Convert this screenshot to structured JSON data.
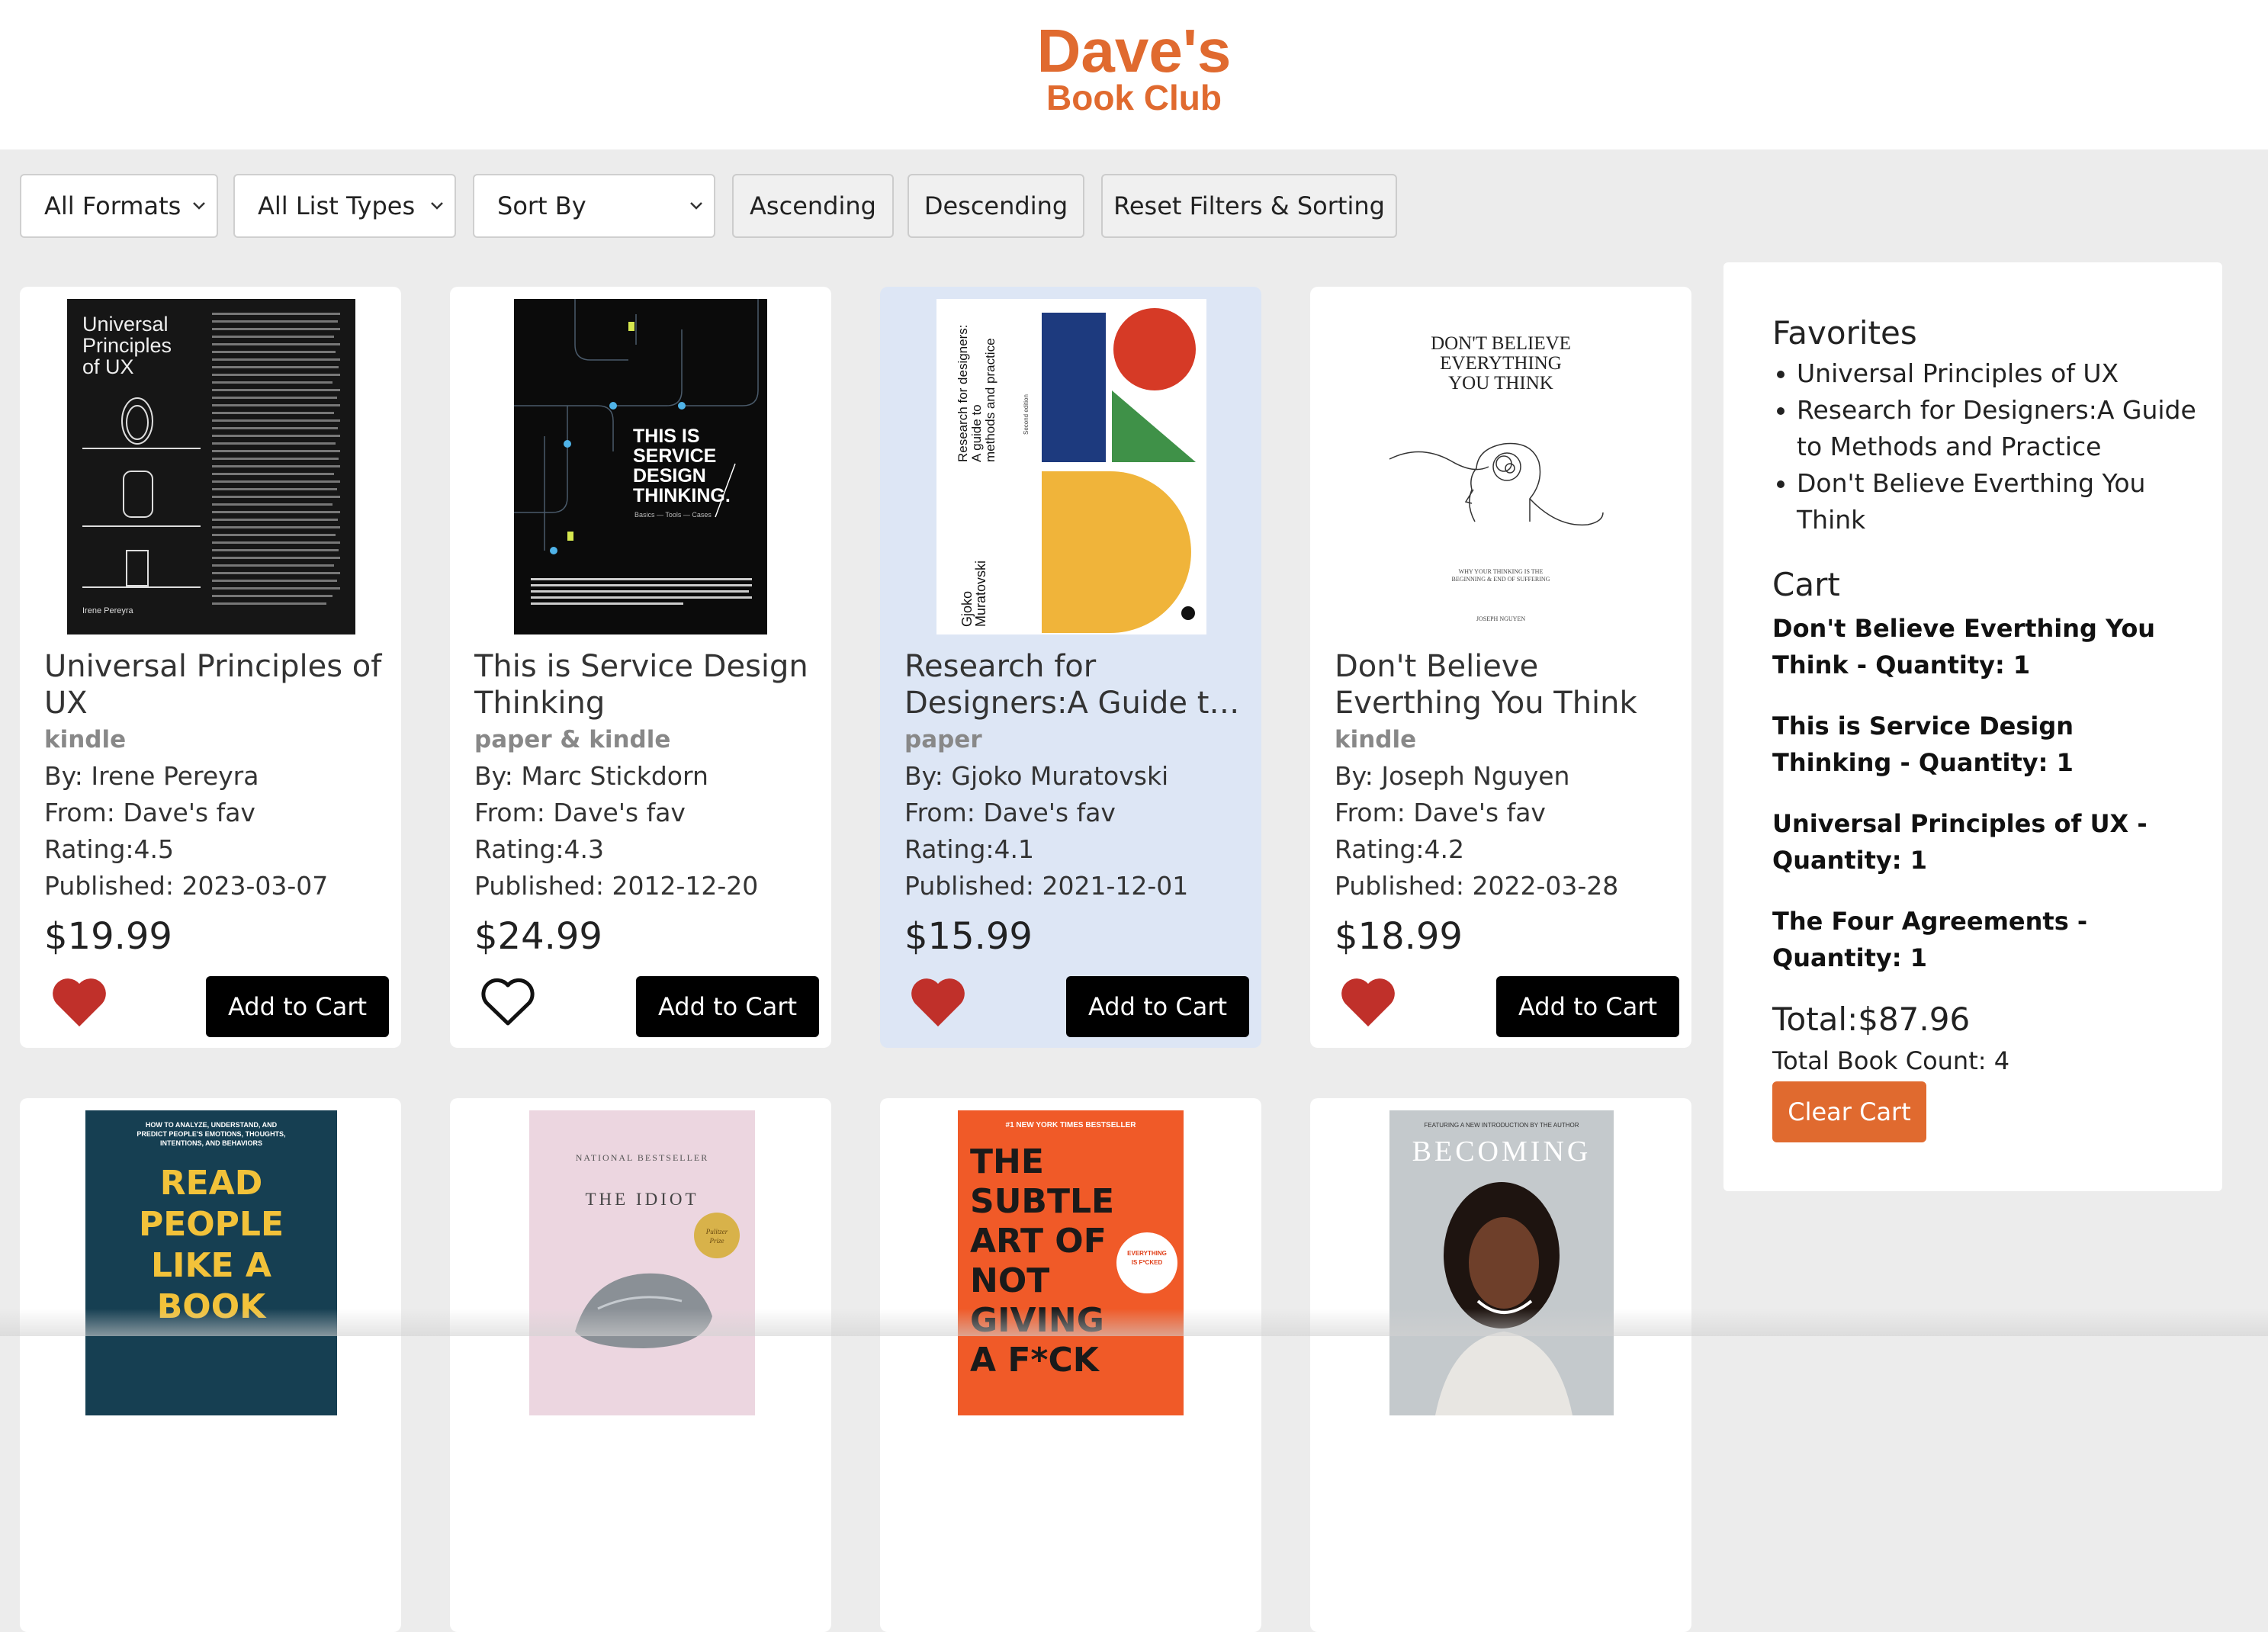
{
  "header": {
    "logo_main": "Dave's",
    "logo_sub": "Book Club"
  },
  "toolbar": {
    "format_select": "All Formats",
    "list_type_select": "All List Types",
    "sort_select": "Sort By",
    "ascending": "Ascending",
    "descending": "Descending",
    "reset": "Reset Filters & Sorting"
  },
  "books": [
    {
      "title": "Universal Principles of UX",
      "format": "kindle",
      "author": "By: Irene Pereyra",
      "from": "From: Dave's fav",
      "rating": "Rating:4.5",
      "published": "Published: 2023-03-07",
      "price": "$19.99",
      "favorited": true,
      "button": "Add to Cart",
      "cover_title": "Universal Principles of UX",
      "cover_author": "Irene Pereyra"
    },
    {
      "title": "This is Service Design Thinking",
      "format": "paper & kindle",
      "author": "By: Marc Stickdorn",
      "from": "From: Dave's fav",
      "rating": "Rating:4.3",
      "published": "Published: 2012-12-20",
      "price": "$24.99",
      "favorited": false,
      "button": "Add to Cart",
      "cover_title": "THIS IS SERVICE DESIGN THINKING.",
      "cover_sub": "Basics — Tools — Cases"
    },
    {
      "title": "Research for Designers:A Guide to Methods and Practice",
      "format": "paper",
      "author": "By: Gjoko Muratovski",
      "from": "From: Dave's fav",
      "rating": "Rating:4.1",
      "published": "Published: 2021-12-01",
      "price": "$15.99",
      "favorited": true,
      "button": "Add to Cart",
      "cover_title": "Research for designers: A guide to methods and practice",
      "cover_author": "Gjoko Muratovski"
    },
    {
      "title": "Don't Believe Everthing You Think",
      "format": "kindle",
      "author": "By: Joseph Nguyen",
      "from": "From: Dave's fav",
      "rating": "Rating:4.2",
      "published": "Published: 2022-03-28",
      "price": "$18.99",
      "favorited": true,
      "button": "Add to Cart",
      "cover_title": "DON'T BELIEVE EVERYTHING YOU THINK",
      "cover_sub": "WHY YOUR THINKING IS THE BEGINNING & END OF SUFFERING",
      "cover_author": "JOSEPH NGUYEN"
    }
  ],
  "books_row2": [
    {
      "cover_top": "HOW TO ANALYZE, UNDERSTAND, AND PREDICT PEOPLE'S EMOTIONS, THOUGHTS, INTENTIONS, AND BEHAVIORS",
      "cover_title": "READ PEOPLE LIKE A BOOK"
    },
    {
      "cover_top": "NATIONAL BESTSELLER",
      "cover_title": "THE IDIOT",
      "cover_badge": "Pulitzer Prize FINALIST"
    },
    {
      "cover_top": "#1 NEW YORK TIMES BESTSELLER",
      "cover_title": "THE SUBTLE ART OF NOT GIVING A F*CK"
    },
    {
      "cover_top": "FEATURING A NEW INTRODUCTION BY THE AUTHOR",
      "cover_title": "BECOMING"
    }
  ],
  "sidebar": {
    "favorites_heading": "Favorites",
    "favorites": [
      "Universal Principles of UX",
      "Research for Designers:A Guide to Methods and Practice",
      "Don't Believe Everthing You Think"
    ],
    "cart_heading": "Cart",
    "cart_items": [
      "Don't Believe Everthing You Think - Quantity: 1",
      "This is Service Design Thinking - Quantity: 1",
      "Universal Principles of UX - Quantity: 1",
      "The Four Agreements - Quantity: 1"
    ],
    "total": "Total:$87.96",
    "count": "Total Book Count: 4",
    "clear_button": "Clear Cart"
  },
  "colors": {
    "brand": "#e06a2f",
    "heart": "#c0302a",
    "highlight": "#dde6f5"
  }
}
